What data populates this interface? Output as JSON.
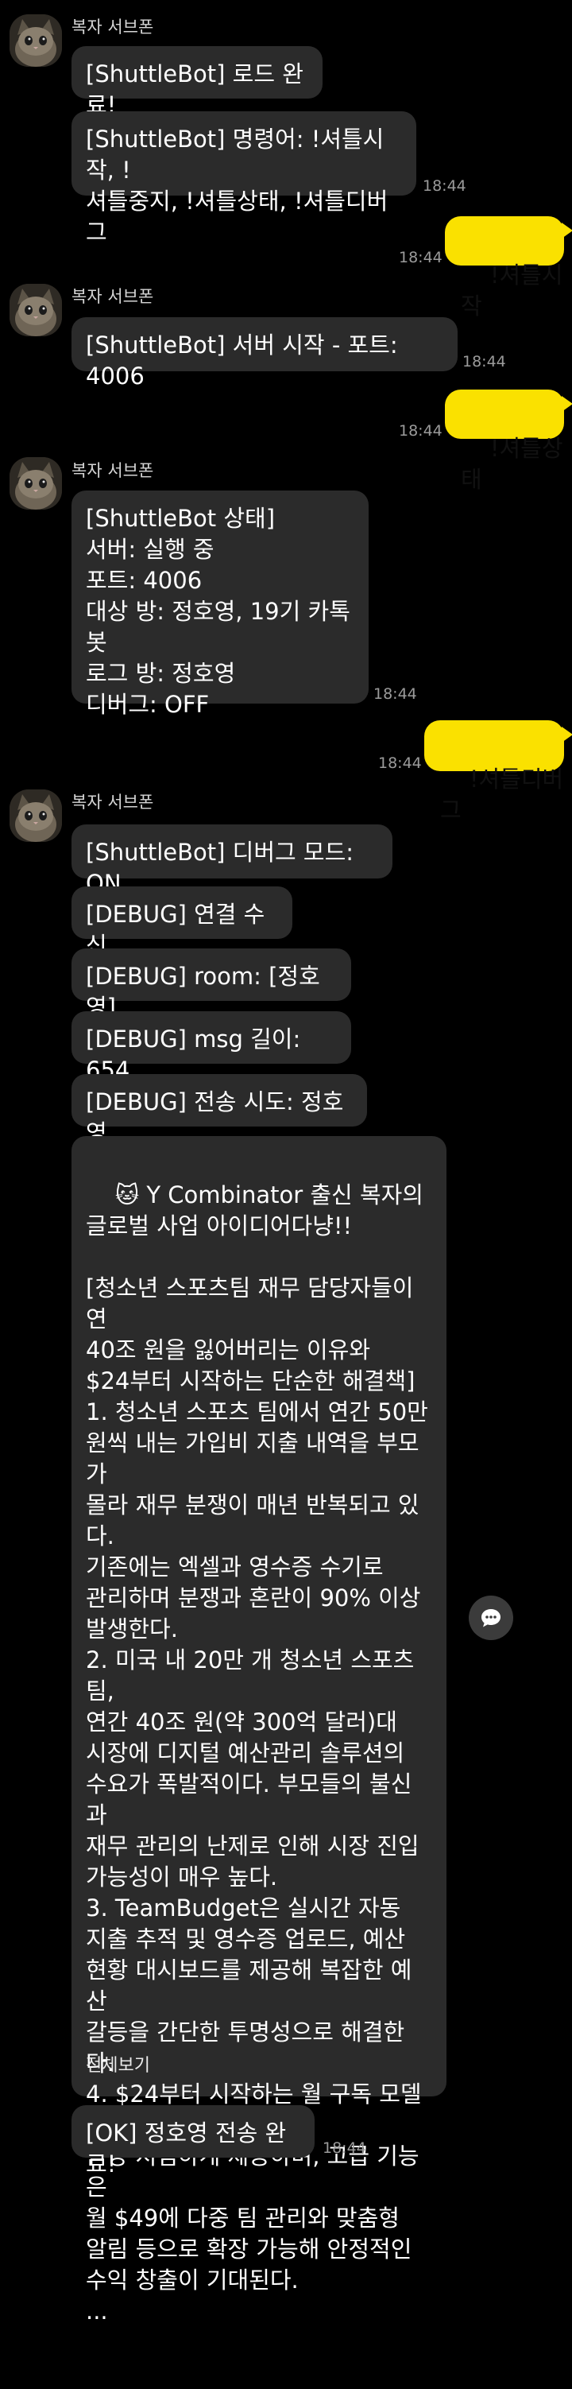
{
  "sender_name": "복자 서브폰",
  "messages": {
    "m1": "[ShuttleBot] 로드 완료!",
    "m2": "[ShuttleBot] 명령어: !셔틀시작, !\n셔틀중지, !셔틀상태, !셔틀디버그",
    "m3": "!셔틀시작",
    "m4": "[ShuttleBot] 서버 시작 - 포트: 4006",
    "m5": "!셔틀상태",
    "m6": "[ShuttleBot 상태]\n서버: 실행 중\n포트: 4006\n대상 방: 정호영, 19기 카톡봇\n로그 방: 정호영\n디버그: OFF",
    "m7": "!셔틀디버그",
    "m8": "[ShuttleBot] 디버그 모드: ON",
    "m9": "[DEBUG] 연결 수신",
    "m10": "[DEBUG] room: [정호영]",
    "m11": "[DEBUG] msg 길이: 654",
    "m12": "[DEBUG] 전송 시도: 정호영",
    "m13": "🐱 Y Combinator 출신 복자의\n글로벌 사업 아이디어다냥!!\n\n[청소년 스포츠팀 재무 담당자들이 연\n40조 원을 잃어버리는 이유와\n$24부터 시작하는 단순한 해결책]\n1. 청소년 스포츠 팀에서 연간 50만\n원씩 내는 가입비 지출 내역을 부모가\n몰라 재무 분쟁이 매년 반복되고 있다.\n기존에는 엑셀과 영수증 수기로\n관리하며 분쟁과 혼란이 90% 이상\n발생한다.\n2. 미국 내 20만 개 청소년 스포츠 팀,\n연간 40조 원(약 300억 달러)대\n시장에 디지털 예산관리 솔루션의\n수요가 폭발적이다. 부모들의 불신과\n재무 관리의 난제로 인해 시장 진입\n가능성이 매우 높다.\n3. TeamBudget은 실시간 자동\n지출 추적 및 영수증 업로드, 예산\n현황 대시보드를 제공해 복잡한 예산\n갈등을 간단한 투명성으로 해결한다.\n4. $24부터 시작하는 월 구독 모델로\n팀당 저렴하게 제공하며, 고급 기능은\n월 $49에 다중 팀 관리와 맞춤형\n알림 등으로 확장 가능해 안정적인\n수익 창출이 기대된다.\n...",
    "m13_see_all": "전체보기",
    "m14": "[OK] 정호영 전송 완료!"
  },
  "times": {
    "t1": "18:44",
    "t2": "18:44",
    "t3": "18:44",
    "t4": "18:44",
    "t5": "18:44",
    "t6": "18:44",
    "t7": "18:44"
  },
  "colors": {
    "background": "#000000",
    "incoming_bubble": "#2b2b2b",
    "outgoing_bubble": "#fae100",
    "timestamp": "#9b9b9b"
  },
  "icons": {
    "avatar": "cat-avatar-icon",
    "side_button": "chat-bubble-icon"
  }
}
